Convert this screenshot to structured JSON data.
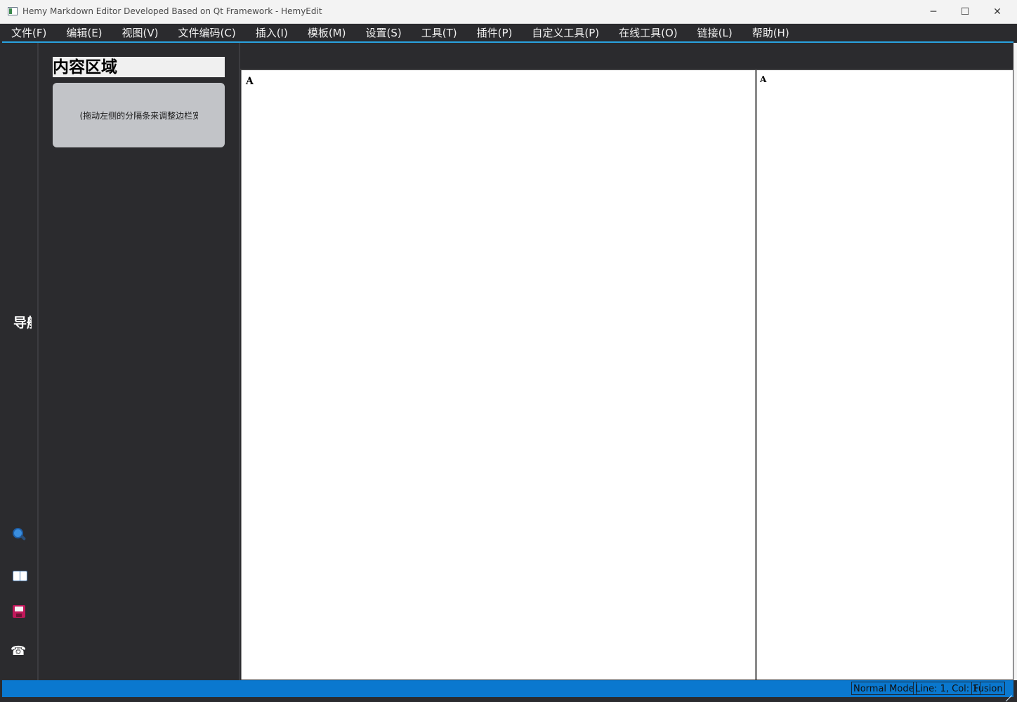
{
  "window": {
    "title": "Hemy Markdown Editor Developed Based on Qt Framework - HemyEdit",
    "minimize_glyph": "─",
    "maximize_glyph": "☐",
    "close_glyph": "✕"
  },
  "menu": [
    {
      "label": "文件(F)"
    },
    {
      "label": "编辑(E)"
    },
    {
      "label": "视图(V)"
    },
    {
      "label": "文件编码(C)"
    },
    {
      "label": "插入(I)"
    },
    {
      "label": "模板(M)"
    },
    {
      "label": "设置(S)"
    },
    {
      "label": "工具(T)"
    },
    {
      "label": "插件(P)"
    },
    {
      "label": "自定义工具(P)"
    },
    {
      "label": "在线工具(O)"
    },
    {
      "label": "链接(L)"
    },
    {
      "label": "帮助(H)"
    }
  ],
  "rail": {
    "title": "导航",
    "icons": [
      "search-icon",
      "book-icon",
      "save-icon",
      "phone-icon"
    ],
    "phone_glyph": "☎"
  },
  "sidebar": {
    "content_title": "内容区域",
    "hint": "(拖动左侧的分隔条来调整边栏宽度)"
  },
  "editor": {
    "text": "A"
  },
  "preview": {
    "text": "A"
  },
  "status": {
    "mode": "Normal Mode",
    "position": "Line: 1, Col: 1",
    "style": "Fusion"
  },
  "colors": {
    "accent": "#29a3e0",
    "statusbar": "#0a78cf",
    "dark_bg": "#2b2b2e"
  }
}
